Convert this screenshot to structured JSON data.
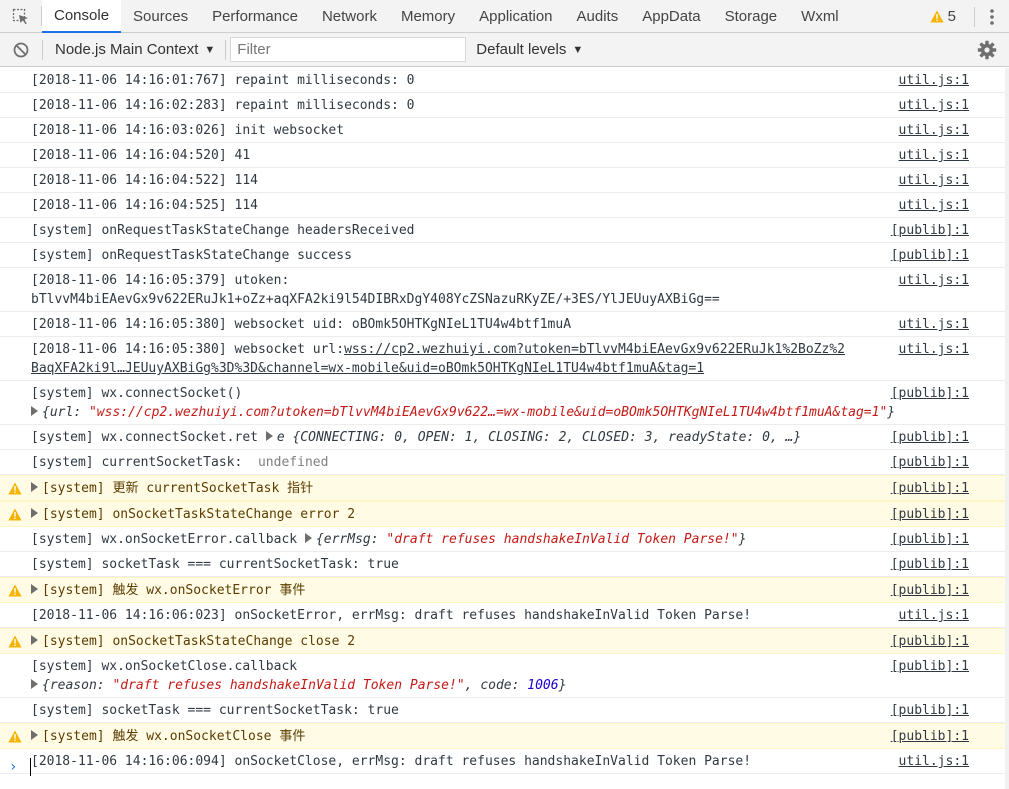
{
  "tabs": [
    {
      "label": "Console",
      "active": true
    },
    {
      "label": "Sources"
    },
    {
      "label": "Performance"
    },
    {
      "label": "Network"
    },
    {
      "label": "Memory"
    },
    {
      "label": "Application"
    },
    {
      "label": "Audits"
    },
    {
      "label": "AppData"
    },
    {
      "label": "Storage"
    },
    {
      "label": "Wxml"
    }
  ],
  "warnings_count": "5",
  "toolbar": {
    "context": "Node.js Main Context",
    "filter_placeholder": "Filter",
    "levels": "Default levels"
  },
  "colors": {
    "accent": "#1a73e8",
    "warning_bg": "#fffbe5",
    "warning_icon": "#f4b400",
    "string": "#c41a16",
    "number": "#1c00cf"
  },
  "log": [
    {
      "text": "[2018-11-06 14:16:01:767] repaint milliseconds: 0",
      "source": "util.js:1"
    },
    {
      "text": "[2018-11-06 14:16:02:283] repaint milliseconds: 0",
      "source": "util.js:1"
    },
    {
      "text": "[2018-11-06 14:16:03:026] init websocket",
      "source": "util.js:1"
    },
    {
      "text": "[2018-11-06 14:16:04:520] 41",
      "source": "util.js:1"
    },
    {
      "text": "[2018-11-06 14:16:04:522] 114",
      "source": "util.js:1"
    },
    {
      "text": "[2018-11-06 14:16:04:525] 114",
      "source": "util.js:1"
    },
    {
      "text": "[system] onRequestTaskStateChange headersReceived",
      "source": "[publib]:1"
    },
    {
      "text": "[system] onRequestTaskStateChange success",
      "source": "[publib]:1"
    },
    {
      "text": "[2018-11-06 14:16:05:379] utoken:",
      "text2": "bTlvvM4biEAevGx9v622ERuJk1+oZz+aqXFA2ki9l54DIBRxDgY408YcZSNazuRKyZE/+3ES/YlJEUuyAXBiGg==",
      "source": "util.js:1"
    },
    {
      "text": "[2018-11-06 14:16:05:380] websocket uid: oBOmk5OHTKgNIeL1TU4w4btf1muA",
      "source": "util.js:1"
    },
    {
      "text": "[2018-11-06 14:16:05:380] websocket url:",
      "url1": "wss://cp2.wezhuiyi.com?utoken=bTlvvM4biEAevGx9v622ERuJk1%2BoZz%2",
      "url2": "BaqXFA2ki9l…JEUuyAXBiGg%3D%3D&channel=wx-mobile&uid=oBOmk5OHTKgNIeL1TU4w4btf1muA&tag=1",
      "source": "util.js:1"
    },
    {
      "text": "[system] wx.connectSocket()",
      "obj_key": "url",
      "obj_val": "\"wss://cp2.wezhuiyi.com?utoken=bTlvvM4biEAevGx9v622…=wx-mobile&uid=oBOmk5OHTKgNIeL1TU4w4btf1muA&tag=1\"",
      "source": "[publib]:1"
    },
    {
      "text": "[system] wx.connectSocket.ret",
      "obj_prefix": "e",
      "obj_body": "{CONNECTING: 0, OPEN: 1, CLOSING: 2, CLOSED: 3, readyState: 0, …}",
      "source": "[publib]:1"
    },
    {
      "text": "[system] currentSocketTask:",
      "undef": "undefined",
      "source": "[publib]:1"
    },
    {
      "text": "[system] 更新 currentSocketTask 指针",
      "source": "[publib]:1",
      "warn": true
    },
    {
      "text": "[system] onSocketTaskStateChange error 2",
      "source": "[publib]:1",
      "warn": true
    },
    {
      "text": "[system] wx.onSocketError.callback",
      "obj_key": "errMsg",
      "obj_val": "\"draft refuses handshakeInValid Token Parse!\"",
      "source": "[publib]:1"
    },
    {
      "text": "[system] socketTask === currentSocketTask: true",
      "source": "[publib]:1"
    },
    {
      "text": "[system] 触发 wx.onSocketError 事件",
      "source": "[publib]:1",
      "warn": true
    },
    {
      "text": "[2018-11-06 14:16:06:023] onSocketError, errMsg: draft refuses handshakeInValid Token Parse!",
      "source": "util.js:1"
    },
    {
      "text": "[system] onSocketTaskStateChange close 2",
      "source": "[publib]:1",
      "warn": true
    },
    {
      "text": "[system] wx.onSocketClose.callback",
      "obj_key": "reason",
      "obj_val": "\"draft refuses handshakeInValid Token Parse!\"",
      "obj_key2": "code",
      "obj_num": "1006",
      "source": "[publib]:1"
    },
    {
      "text": "[system] socketTask === currentSocketTask: true",
      "source": "[publib]:1"
    },
    {
      "text": "[system] 触发 wx.onSocketClose 事件",
      "source": "[publib]:1",
      "warn": true
    },
    {
      "text": "[2018-11-06 14:16:06:094] onSocketClose, errMsg: draft refuses handshakeInValid Token Parse!",
      "source": "util.js:1"
    }
  ]
}
